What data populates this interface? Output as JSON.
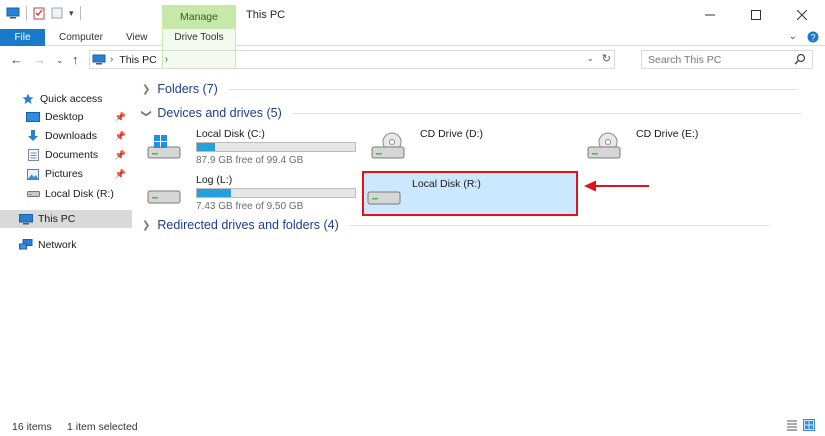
{
  "window": {
    "title": "This PC",
    "contextual_tab": "Manage",
    "controls": [
      "minimize",
      "maximize",
      "close"
    ]
  },
  "ribbon": {
    "tabs": [
      {
        "label": "File",
        "active": true
      },
      {
        "label": "Computer"
      },
      {
        "label": "View"
      },
      {
        "label": "Drive Tools"
      }
    ]
  },
  "address": {
    "path": "This PC",
    "search_placeholder": "Search This PC"
  },
  "nav": {
    "items": [
      {
        "label": "Quick access",
        "icon": "star-icon"
      },
      {
        "label": "Desktop",
        "icon": "desktop-folder-icon",
        "pinned": true
      },
      {
        "label": "Downloads",
        "icon": "download-arrow-icon",
        "pinned": true
      },
      {
        "label": "Documents",
        "icon": "documents-icon",
        "pinned": true
      },
      {
        "label": "Pictures",
        "icon": "pictures-icon",
        "pinned": true
      },
      {
        "label": "Local Disk (R:)",
        "icon": "drive-icon"
      },
      {
        "label": "This PC",
        "icon": "computer-icon",
        "selected": true
      },
      {
        "label": "Network",
        "icon": "network-icon"
      }
    ]
  },
  "groups": {
    "folders": "Folders (7)",
    "devices": "Devices and drives (5)",
    "redirected": "Redirected drives and folders (4)"
  },
  "drives": [
    {
      "name": "Local Disk (C:)",
      "free": "87.9 GB free of 99.4 GB",
      "used_fraction": 0.115,
      "icon": "windows-drive-icon"
    },
    {
      "name": "CD Drive (D:)",
      "icon": "cd-drive-icon"
    },
    {
      "name": "CD Drive (E:)",
      "icon": "cd-drive-icon"
    },
    {
      "name": "Log (L:)",
      "free": "7.43 GB free of 9.50 GB",
      "used_fraction": 0.218,
      "icon": "drive-icon"
    },
    {
      "name": "Local Disk (R:)",
      "icon": "drive-icon",
      "selected": true
    }
  ],
  "annotation": {
    "color": "#e0121a"
  },
  "status": {
    "items": "16 items",
    "selected": "1 item selected"
  },
  "colors": {
    "file_tab": "#1979ca",
    "manage_tab": "#c6e8a8",
    "selection": "#cce8ff",
    "usage_bar": "#26a0da",
    "group_header": "#1e3d8f"
  }
}
